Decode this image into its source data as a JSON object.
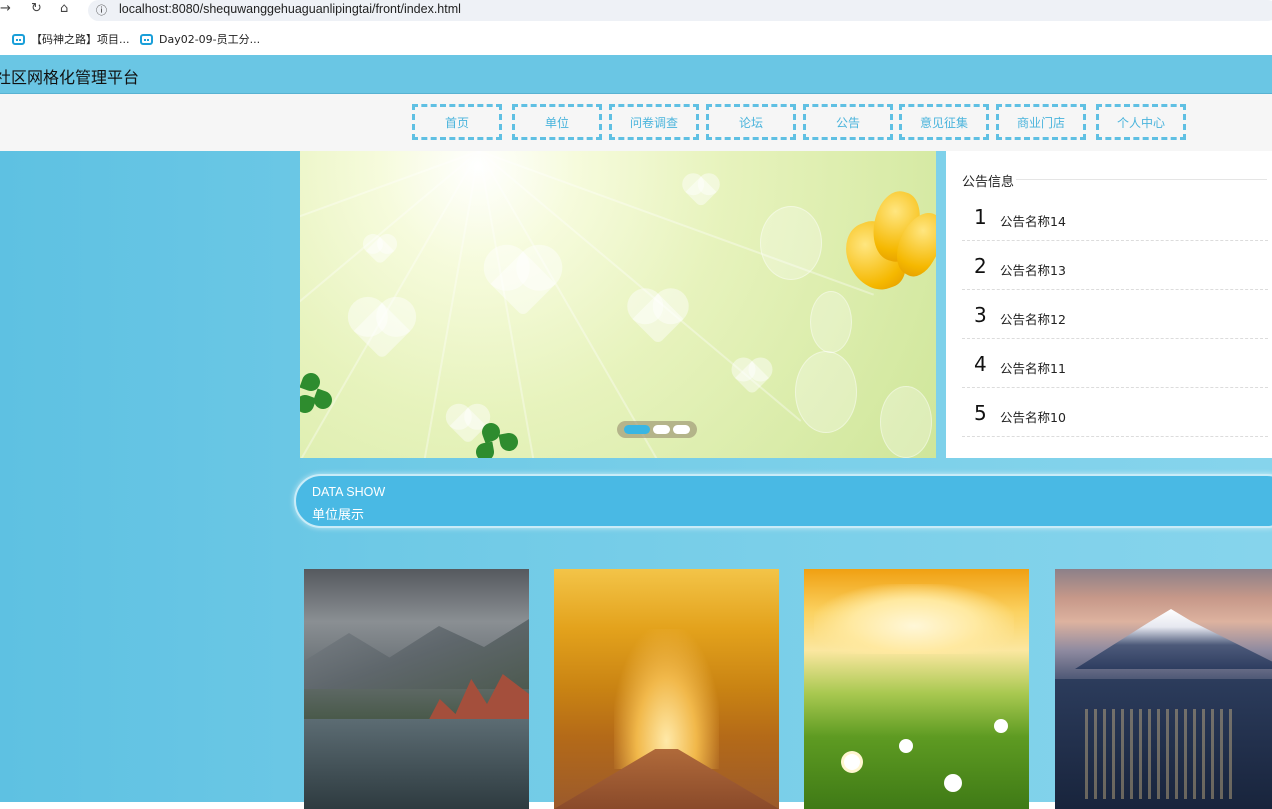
{
  "browser": {
    "url": "localhost:8080/shequwanggehuaguanlipingtai/front/index.html",
    "bookmarks": [
      "【码神之路】项目...",
      "Day02-09-员工分..."
    ]
  },
  "site": {
    "title": "社区网格化管理平台"
  },
  "nav": {
    "items": [
      "首页",
      "单位",
      "问卷调查",
      "论坛",
      "公告",
      "意见征集",
      "商业门店",
      "个人中心"
    ]
  },
  "notice": {
    "title": "公告信息",
    "items": [
      {
        "num": "1",
        "name": "公告名称14"
      },
      {
        "num": "2",
        "name": "公告名称13"
      },
      {
        "num": "3",
        "name": "公告名称12"
      },
      {
        "num": "4",
        "name": "公告名称11"
      },
      {
        "num": "5",
        "name": "公告名称10"
      }
    ]
  },
  "carousel": {
    "slide_count": 3,
    "active_index": 0
  },
  "section": {
    "subtitle_en": "DATA SHOW",
    "title_zh": "单位展示"
  },
  "colors": {
    "header_bg": "#6ac6e4",
    "nav_border": "#5fc0e3",
    "section_bg": "#49b9e4",
    "page_bg": "#6ec9e6"
  }
}
